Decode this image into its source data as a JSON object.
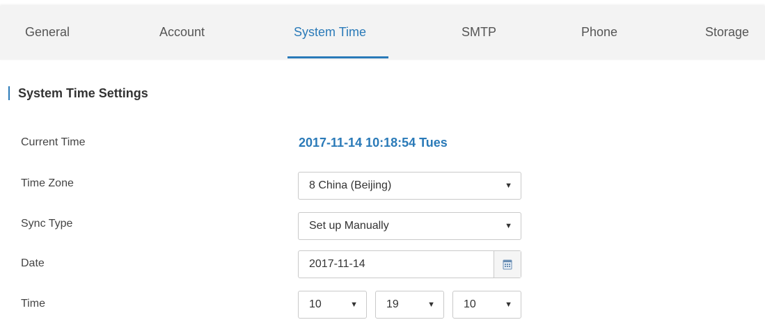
{
  "tabs": [
    {
      "label": "General"
    },
    {
      "label": "Account"
    },
    {
      "label": "System Time"
    },
    {
      "label": "SMTP"
    },
    {
      "label": "Phone"
    },
    {
      "label": "Storage"
    }
  ],
  "active_tab": "System Time",
  "section_title": "System Time Settings",
  "fields": {
    "current_time_label": "Current Time",
    "current_time_value": "2017-11-14 10:18:54 Tues",
    "time_zone_label": "Time Zone",
    "time_zone_value": "8 China (Beijing)",
    "sync_type_label": "Sync Type",
    "sync_type_value": "Set up Manually",
    "date_label": "Date",
    "date_value": "2017-11-14",
    "time_label": "Time",
    "time_hour": "10",
    "time_minute": "19",
    "time_second": "10"
  },
  "colors": {
    "accent": "#2a7ab8",
    "tabbar_bg": "#f3f3f3"
  },
  "icons": {
    "dropdown": "caret-down-icon",
    "date_picker": "calendar-icon"
  }
}
